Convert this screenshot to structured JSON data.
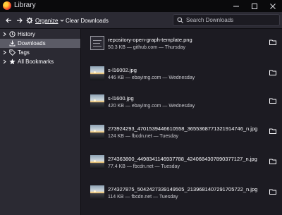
{
  "window": {
    "title": "Library",
    "controls": [
      "minimize",
      "maximize",
      "close"
    ]
  },
  "toolbar": {
    "organize_label": "Organize",
    "clear_downloads_label": "Clear Downloads",
    "search_placeholder": "Search Downloads"
  },
  "sidebar": {
    "items": [
      {
        "label": "History",
        "icon": "clock-icon",
        "selected": false
      },
      {
        "label": "Downloads",
        "icon": "download-icon",
        "selected": true
      },
      {
        "label": "Tags",
        "icon": "tag-icon",
        "selected": false
      },
      {
        "label": "All Bookmarks",
        "icon": "star-icon",
        "selected": false
      }
    ]
  },
  "downloads": [
    {
      "name": "repository-open-graph-template.png",
      "meta": "50.3 KB — github.com — Thursday",
      "thumb": "file"
    },
    {
      "name": "s-l16002.jpg",
      "meta": "446 KB — ebayimg.com — Wednesday",
      "thumb": "image"
    },
    {
      "name": "s-l1600.jpg",
      "meta": "420 KB — ebayimg.com — Wednesday",
      "thumb": "image"
    },
    {
      "name": "273924293_4701539446610558_3655368771321914746_n.jpg",
      "meta": "124 KB — fbcdn.net — Tuesday",
      "thumb": "image"
    },
    {
      "name": "274363800_4498341146937788_4240684307890377127_n.jpg",
      "meta": "77.4 KB — fbcdn.net — Tuesday",
      "thumb": "image"
    },
    {
      "name": "274327875_5042427339149505_2139681407291705722_n.jpg",
      "meta": "114 KB — fbcdn.net — Tuesday",
      "thumb": "image"
    }
  ]
}
